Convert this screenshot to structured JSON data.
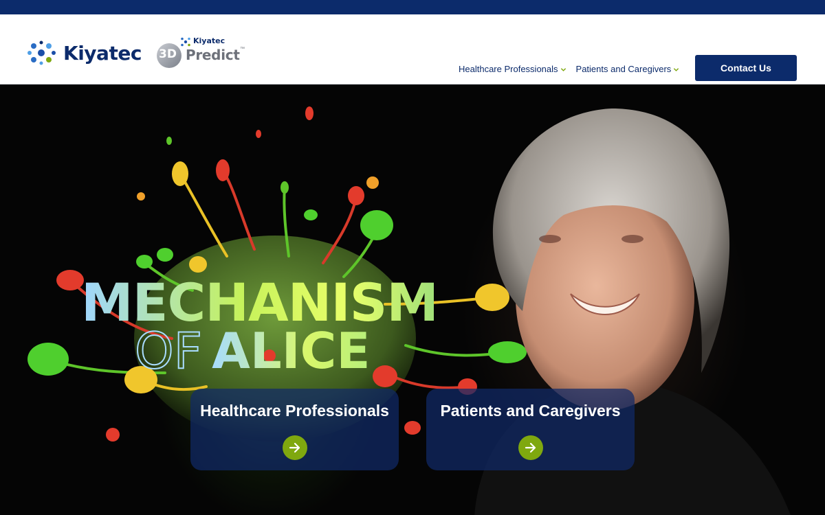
{
  "brand": {
    "name": "Kiyatec",
    "sub_brand": "Kiyatec",
    "product_prefix": "3D",
    "product_name": "Predict",
    "trademark": "™",
    "primary_color": "#0c2b6b",
    "accent_color": "#7fa80f"
  },
  "nav": {
    "items": [
      {
        "label": "Healthcare Professionals",
        "icon": "chevron-down-icon"
      },
      {
        "label": "Patients and Caregivers",
        "icon": "chevron-down-icon"
      }
    ],
    "contact_label": "Contact Us"
  },
  "hero": {
    "title_line1": "MECHANISM",
    "title_of": "OF",
    "title_alice": "ALICE",
    "cards": [
      {
        "label": "Healthcare Professionals",
        "icon": "arrow-right-icon"
      },
      {
        "label": "Patients and Caregivers",
        "icon": "arrow-right-icon"
      }
    ]
  }
}
